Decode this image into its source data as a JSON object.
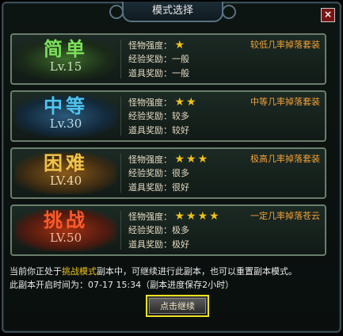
{
  "dialog": {
    "title": "模式选择",
    "close_label": "×"
  },
  "modes": [
    {
      "name": "简单",
      "level": "Lv.15",
      "monster_label": "怪物强度：",
      "stars": "★",
      "exp_label": "经验奖励：",
      "exp_value": "一般",
      "item_label": "道具奖励：",
      "item_value": "一般",
      "drop_text": "较低几率掉落套装",
      "name_color": "#7be05a",
      "lv_color": "#c9e0b8"
    },
    {
      "name": "中等",
      "level": "Lv.30",
      "monster_label": "怪物强度：",
      "stars": "★★",
      "exp_label": "经验奖励：",
      "exp_value": "较多",
      "item_label": "道具奖励：",
      "item_value": "较好",
      "drop_text": "中等几率掉落套装",
      "name_color": "#4ec6f0",
      "lv_color": "#bcdcea"
    },
    {
      "name": "困难",
      "level": "LV.40",
      "monster_label": "怪物强度：",
      "stars": "★★★",
      "exp_label": "经验奖励：",
      "exp_value": "很多",
      "item_label": "道具奖励：",
      "item_value": "很好",
      "drop_text": "极高几率掉落套装",
      "name_color": "#f0c24a",
      "lv_color": "#f0d8a8"
    },
    {
      "name": "挑战",
      "level": "LV.50",
      "monster_label": "怪物强度：",
      "stars": "★★★★",
      "exp_label": "经验奖励：",
      "exp_value": "极多",
      "item_label": "道具奖励：",
      "item_value": "极好",
      "drop_text": "一定几率掉落苍云",
      "name_color": "#ff5a2a",
      "lv_color": "#f0b8a0"
    }
  ],
  "notice": {
    "line1_prefix": "当前你正处于",
    "line1_highlight": "挑战模式",
    "line1_suffix": "副本中，可继续进行此副本，也可以重置副本模式。",
    "line2": "此副本开启时间为：07-17 15:34（副本进度保存2小时）"
  },
  "continue_button": "点击继续"
}
